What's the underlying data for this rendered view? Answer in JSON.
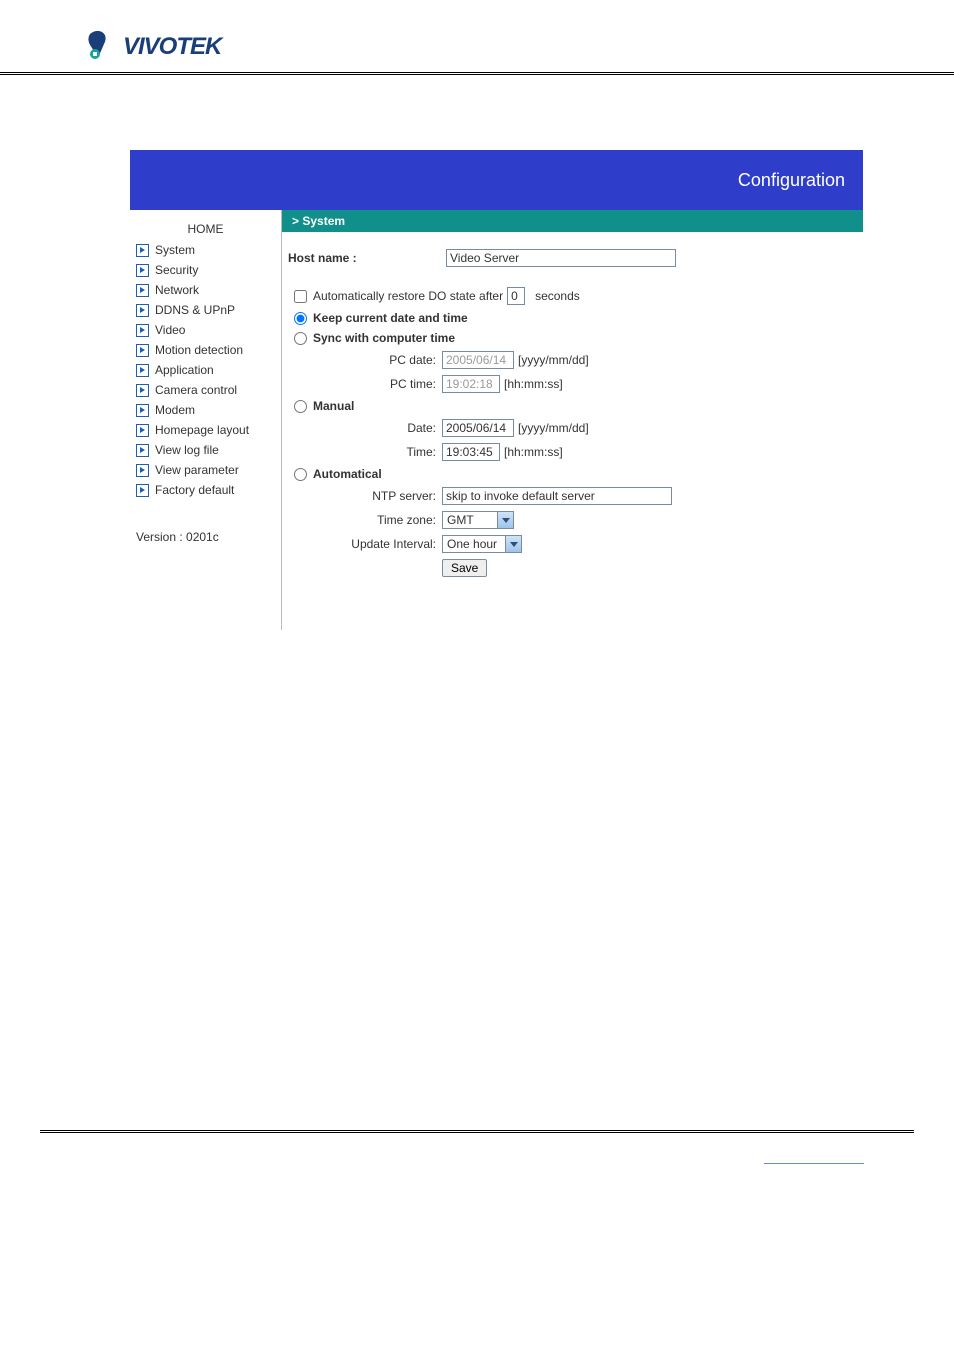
{
  "brand": "VIVOTEK",
  "header": {
    "title": "Configuration"
  },
  "sidebar": {
    "home": "HOME",
    "items": [
      "System",
      "Security",
      "Network",
      "DDNS & UPnP",
      "Video",
      "Motion detection",
      "Application",
      "Camera control",
      "Modem",
      "Homepage layout",
      "View log file",
      "View parameter",
      "Factory default"
    ],
    "version": "Version : 0201c"
  },
  "section": {
    "title": "> System"
  },
  "form": {
    "host_label": "Host name :",
    "host_value": "Video Server",
    "auto_restore_label_prefix": "Automatically restore DO state after",
    "auto_restore_value": "0",
    "auto_restore_label_suffix": "seconds",
    "opt_keep": "Keep current date and time",
    "opt_sync": "Sync with computer time",
    "pc_date_label": "PC date:",
    "pc_date_value": "2005/06/14",
    "pc_date_hint": "[yyyy/mm/dd]",
    "pc_time_label": "PC time:",
    "pc_time_value": "19:02:18",
    "pc_time_hint": "[hh:mm:ss]",
    "opt_manual": "Manual",
    "date_label": "Date:",
    "date_value": "2005/06/14",
    "date_hint": "[yyyy/mm/dd]",
    "time_label": "Time:",
    "time_value": "19:03:45",
    "time_hint": "[hh:mm:ss]",
    "opt_auto": "Automatical",
    "ntp_label": "NTP server:",
    "ntp_value": "skip to invoke default server",
    "tz_label": "Time zone:",
    "tz_value": "GMT",
    "interval_label": "Update Interval:",
    "interval_value": "One hour",
    "save": "Save"
  }
}
